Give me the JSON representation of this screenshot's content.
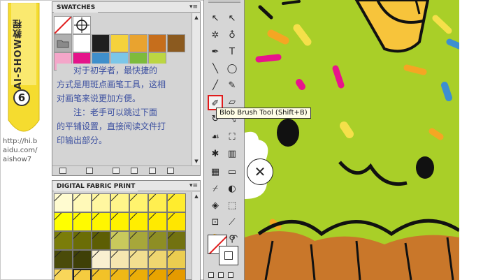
{
  "banner": {
    "title_vertical": "AI-SHOW教程",
    "number": "6",
    "site_url_lines": [
      "http://hi.b",
      "aidu.com/",
      "aishow7"
    ]
  },
  "swatches_panel": {
    "tab_label": "SWATCHES",
    "menu_glyph": "▾≡",
    "instructions_line1": "对于初学者，最快捷的",
    "instructions_line2": "方式是用斑点画笔工具，这相",
    "instructions_line3": "对画笔来说更加方便。",
    "instructions_line4": "注：老手可以跳过下面",
    "instructions_line5": "的平铺设置，直接阅读文件打",
    "instructions_line6": "印输出部分。",
    "colors": {
      "row1": [
        "none",
        "registration"
      ],
      "row2": [
        "#a8a8a8",
        "#ffffff",
        "#1f1f1f",
        "#f5d23c",
        "#e9a32f",
        "#c66e1c",
        "#8b5a1f"
      ],
      "row3": [
        "#f4a6c9",
        "#e5138a",
        "#3f8fcb",
        "#7bc6e8",
        "#7dbb3c",
        "#bcd642"
      ]
    }
  },
  "fabric_panel": {
    "tab_label": "DIGITAL FABRIC PRINT",
    "menu_glyph": "▾≡",
    "rows": [
      [
        "#fffbd0",
        "#fff9b8",
        "#fff7a0",
        "#fff58a",
        "#fff36e",
        "#ffef50",
        "#ffec2e"
      ],
      [
        "#ffff00",
        "#fffa00",
        "#fff600",
        "#fff200",
        "#ffee00",
        "#ffea00",
        "#ffe600"
      ],
      [
        "#7b7d0a",
        "#6b6d06",
        "#5d5e04",
        "#c9c95c",
        "#a7a73a",
        "#8e8e24",
        "#727210"
      ],
      [
        "#4a4b0a",
        "#3f4007",
        "#f9efd0",
        "#f6e6b0",
        "#f2de90",
        "#efd670",
        "#ebcd50"
      ],
      [
        "#f8d65a",
        "#f5cc40",
        "#f2c228",
        "#efb816",
        "#ecae08",
        "#e8a400",
        "#e59a00"
      ]
    ]
  },
  "toolbar": {
    "tools": [
      {
        "name": "selection-tool",
        "glyph": "↖"
      },
      {
        "name": "direct-selection-tool",
        "glyph": "↖"
      },
      {
        "name": "magic-wand-tool",
        "glyph": "✲"
      },
      {
        "name": "lasso-tool",
        "glyph": "♁"
      },
      {
        "name": "pen-tool",
        "glyph": "✒"
      },
      {
        "name": "type-tool",
        "glyph": "T"
      },
      {
        "name": "line-tool",
        "glyph": "╲"
      },
      {
        "name": "ellipse-tool",
        "glyph": "◯"
      },
      {
        "name": "paintbrush-tool",
        "glyph": "╱"
      },
      {
        "name": "pencil-tool",
        "glyph": "✎"
      },
      {
        "name": "blob-brush-tool",
        "glyph": "✐"
      },
      {
        "name": "eraser-tool",
        "glyph": "▱"
      },
      {
        "name": "rotate-tool",
        "glyph": "↻"
      },
      {
        "name": "scale-tool",
        "glyph": "⤡"
      },
      {
        "name": "warp-tool",
        "glyph": "☙"
      },
      {
        "name": "free-transform-tool",
        "glyph": "⛶"
      },
      {
        "name": "symbol-sprayer-tool",
        "glyph": "✱"
      },
      {
        "name": "column-graph-tool",
        "glyph": "▥"
      },
      {
        "name": "mesh-tool",
        "glyph": "▦"
      },
      {
        "name": "gradient-tool",
        "glyph": "▭"
      },
      {
        "name": "eyedropper-tool",
        "glyph": "⌿"
      },
      {
        "name": "blend-tool",
        "glyph": "◐"
      },
      {
        "name": "live-paint-bucket-tool",
        "glyph": "◈"
      },
      {
        "name": "live-paint-selection-tool",
        "glyph": "⬚"
      },
      {
        "name": "artboard-tool",
        "glyph": "⊡"
      },
      {
        "name": "slice-tool",
        "glyph": "⟋"
      },
      {
        "name": "hand-tool",
        "glyph": "✋"
      },
      {
        "name": "zoom-tool",
        "glyph": "⚲"
      }
    ],
    "tooltip": "Blob Brush Tool (Shift+B)",
    "fill_stroke_swap": "↶",
    "fill_color": "#ffffff",
    "stroke_color": "#ffffff"
  },
  "canvas": {
    "background": "#a9cf28",
    "sprinkle_colors": [
      "#f5a623",
      "#e8148c",
      "#3d8fd1",
      "#f5e04a"
    ],
    "cursor_glyph": "✕"
  }
}
